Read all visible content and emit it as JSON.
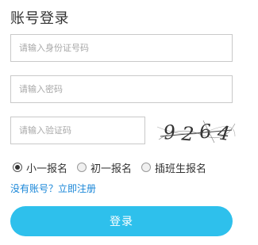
{
  "form": {
    "title": "账号登录",
    "id_field": {
      "value": "",
      "placeholder": "请输入身份证号码"
    },
    "password_field": {
      "value": "",
      "placeholder": "请输入密码"
    },
    "captcha_field": {
      "value": "",
      "placeholder": "请输入验证码"
    },
    "captcha_image": {
      "text": "9264"
    }
  },
  "registration_type": {
    "options": [
      {
        "label": "小一报名",
        "checked": true
      },
      {
        "label": "初一报名",
        "checked": false
      },
      {
        "label": "插班生报名",
        "checked": false
      }
    ]
  },
  "register_link": {
    "label": "没有账号？立即注册"
  },
  "login_button": {
    "label": "登录"
  },
  "colors": {
    "accent": "#2ec0ec",
    "link": "#1a87d8",
    "border": "#c9c9c9"
  }
}
